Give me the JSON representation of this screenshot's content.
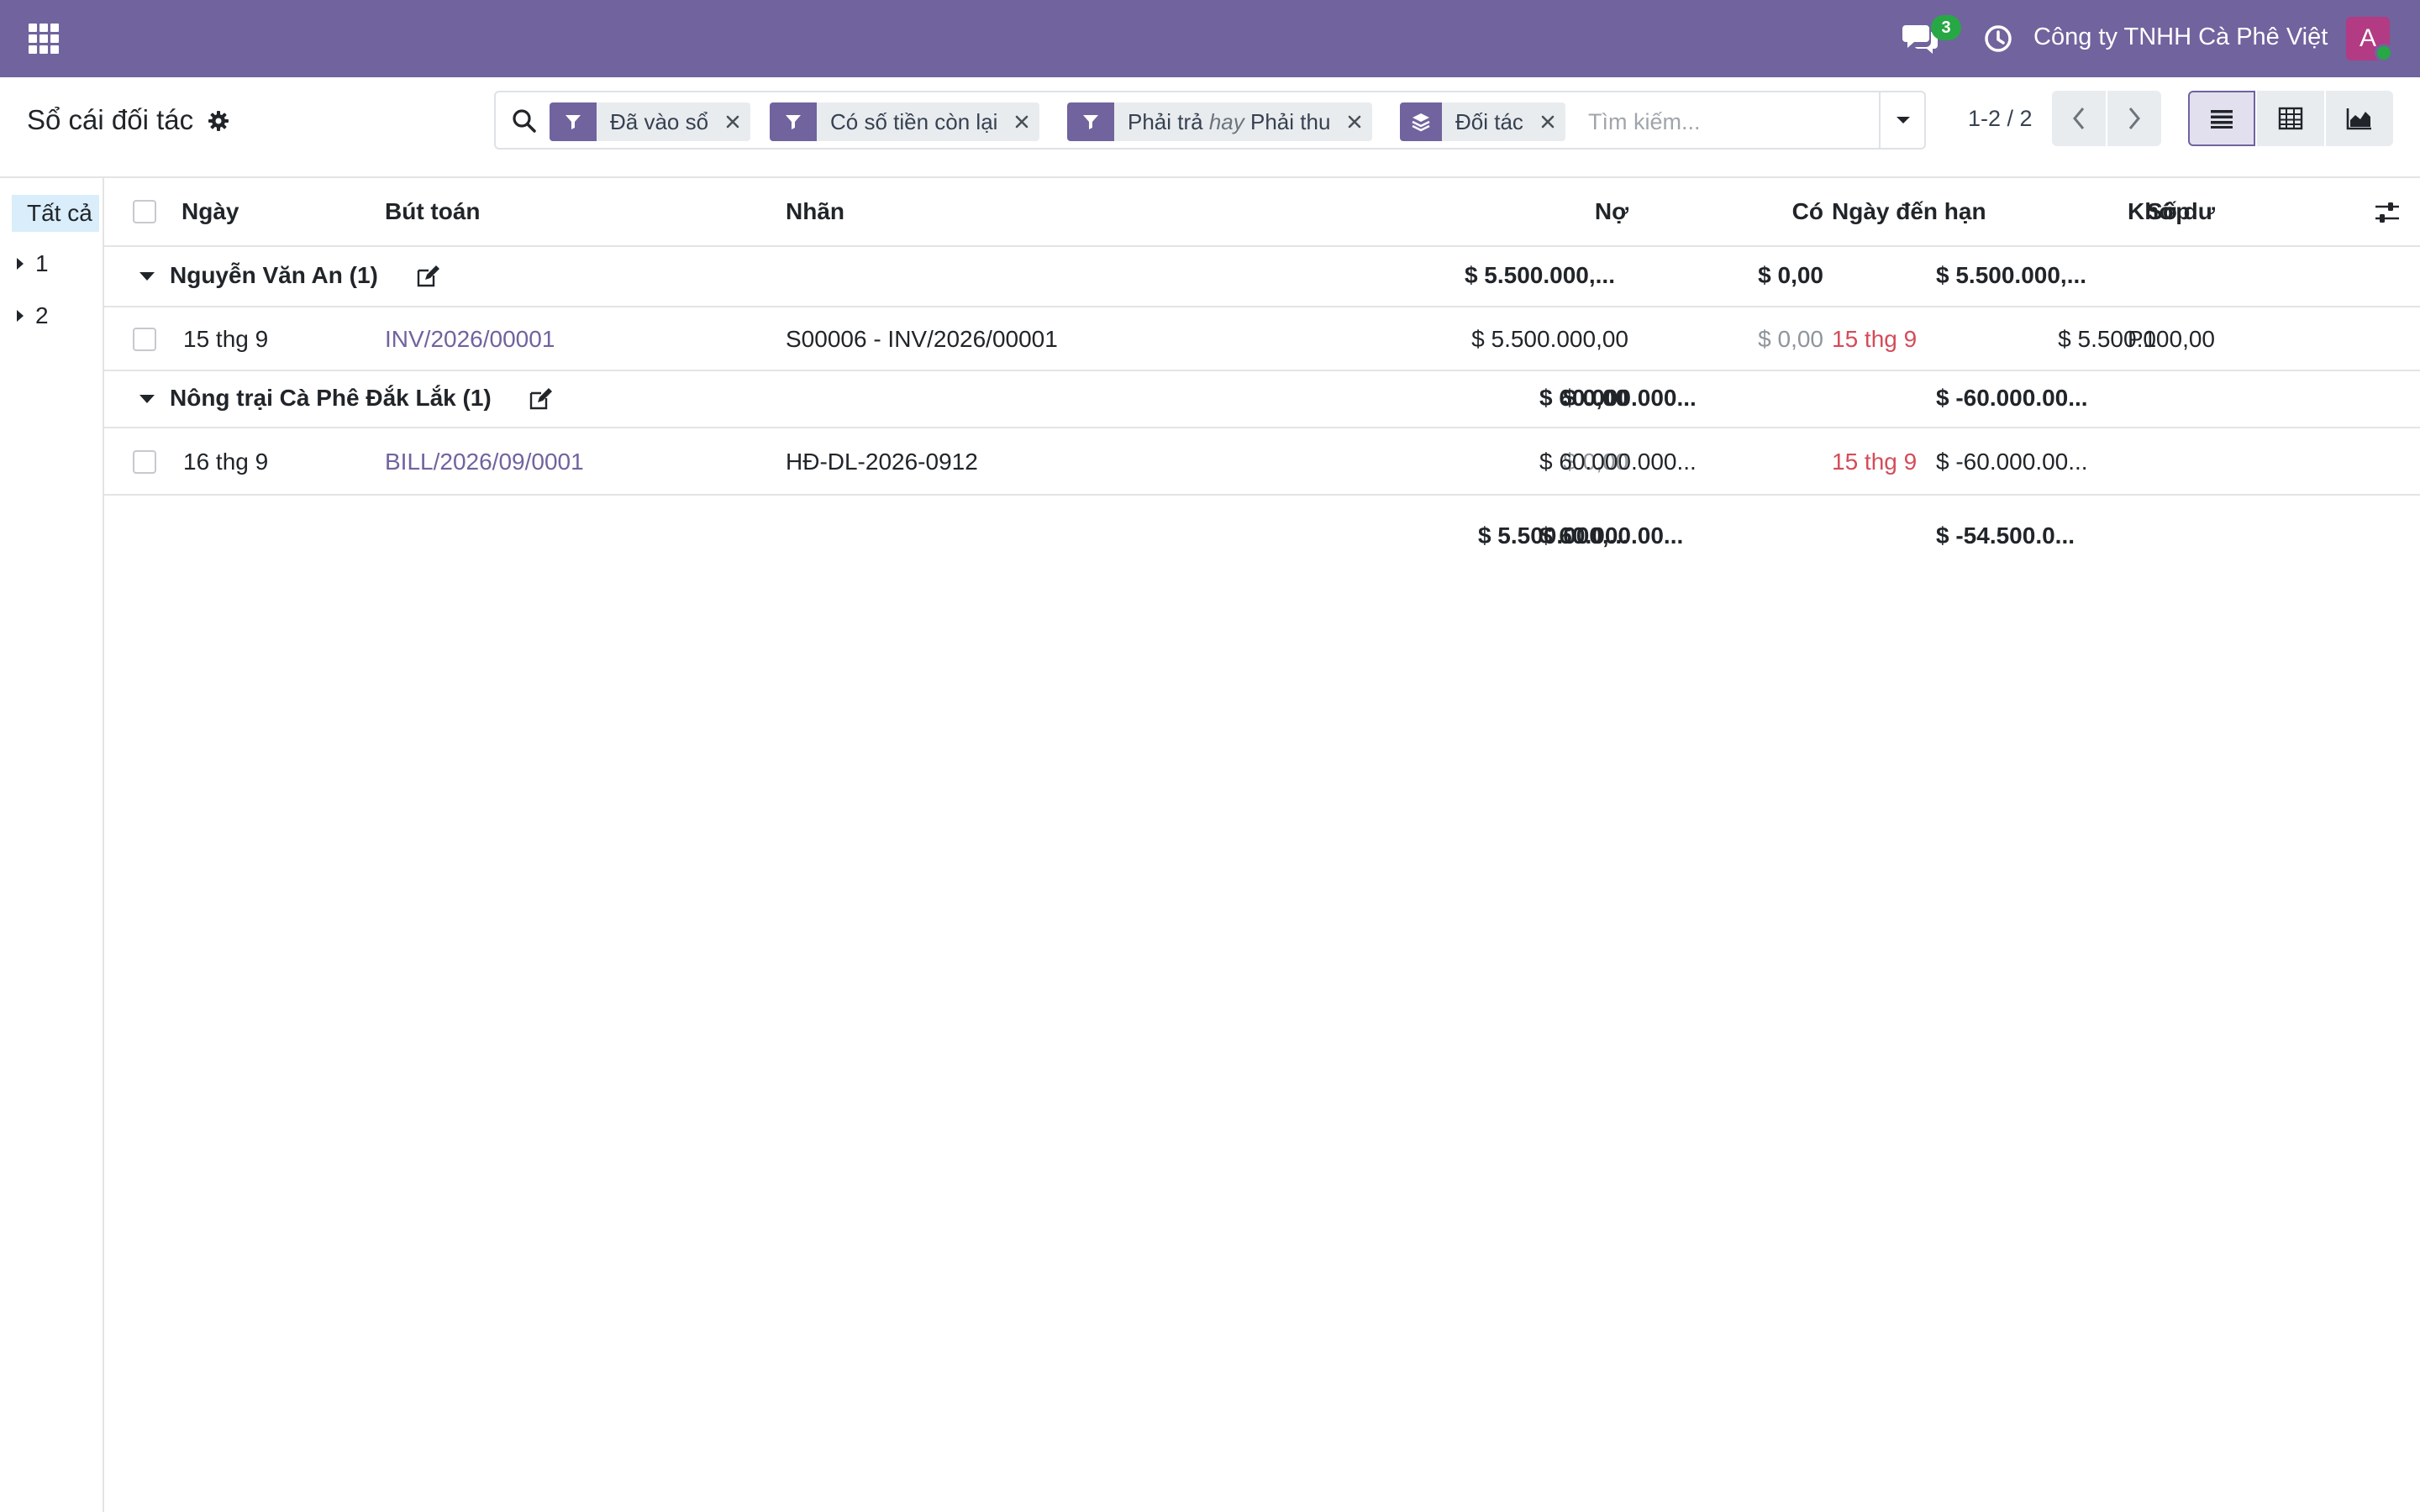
{
  "navbar": {
    "chat_badge": "3",
    "company": "Công ty TNHH Cà Phê Việt",
    "avatar_letter": "A",
    "brand_color": "#71639e",
    "icons": [
      "apps-icon",
      "chat-icon",
      "clock-icon"
    ]
  },
  "control_panel": {
    "title": "Sổ cái đối tác",
    "facets": [
      {
        "type": "filter",
        "label": "Đã vào sổ"
      },
      {
        "type": "filter",
        "label": "Có số tiền còn lại"
      },
      {
        "type": "filter",
        "label_a": "Phải trả",
        "label_or": "hay",
        "label_b": "Phải thu"
      },
      {
        "type": "groupby",
        "label": "Đối tác"
      }
    ],
    "search_placeholder": "Tìm kiếm...",
    "pager": "1-2 / 2",
    "views": [
      "list",
      "pivot",
      "graph"
    ],
    "active_view": "list"
  },
  "side_panel": {
    "all_label": "Tất cả",
    "items": [
      "1",
      "2"
    ]
  },
  "table": {
    "columns": {
      "date": "Ngày",
      "move": "Bút toán",
      "label": "Nhãn",
      "debit": "Nợ",
      "credit": "Có",
      "due_date": "Ngày đến hạn",
      "balance": "Số dư",
      "matching": "Khớp"
    },
    "groups": [
      {
        "name": "Nguyễn Văn An (1)",
        "debit": "$ 5.500.000,...",
        "credit": "$ 0,00",
        "balance": "$ 5.500.000,...",
        "rows": [
          {
            "date": "15 thg 9",
            "move": "INV/2026/00001",
            "label": "S00006 - INV/2026/00001",
            "debit": "$ 5.500.000,00",
            "credit": "$ 0,00",
            "due_date": "15 thg 9",
            "balance": "$ 5.500.000,00",
            "matching": "P1"
          }
        ]
      },
      {
        "name": "Nông trại Cà Phê Đắk Lắk (1)",
        "debit": "$ 0,00",
        "credit": "$ 60.000.000...",
        "balance": "$ -60.000.00...",
        "rows": [
          {
            "date": "16 thg 9",
            "move": "BILL/2026/09/0001",
            "label": "HĐ-DL-2026-0912",
            "debit": "$ 0,00",
            "credit": "$ 60.000.000...",
            "due_date": "15 thg 9",
            "balance": "$ -60.000.00...",
            "matching": ""
          }
        ]
      }
    ],
    "totals": {
      "debit": "$ 5.500.000,...",
      "credit": "$ 60.000.00...",
      "balance": "$ -54.500.0..."
    }
  }
}
